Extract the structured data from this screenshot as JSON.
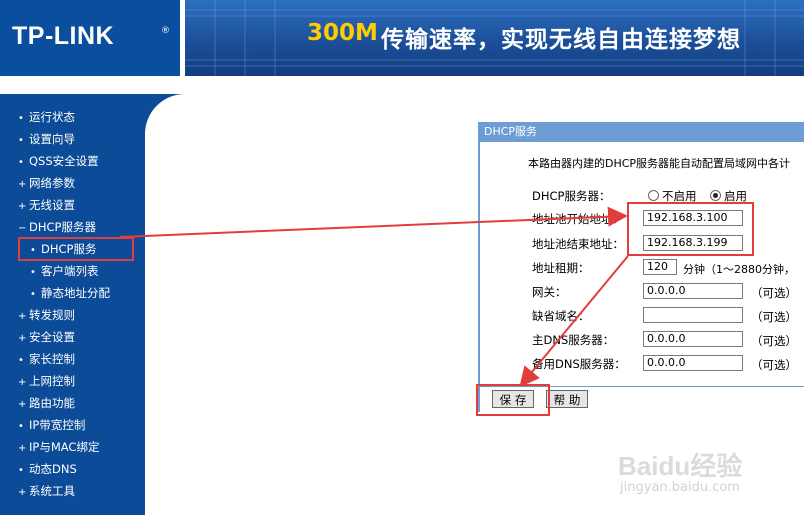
{
  "header": {
    "logo_text": "TP-LINK",
    "logo_mark": "®",
    "slogan_speed": "300M",
    "slogan_text": "传输速率，实现无线自由连接梦想"
  },
  "sidebar": {
    "items": [
      {
        "marker": "•",
        "label": "运行状态"
      },
      {
        "marker": "•",
        "label": "设置向导"
      },
      {
        "marker": "•",
        "label": "QSS安全设置"
      },
      {
        "marker": "+",
        "label": "网络参数"
      },
      {
        "marker": "+",
        "label": "无线设置"
      },
      {
        "marker": "−",
        "label": "DHCP服务器"
      },
      {
        "marker": "•",
        "label": "DHCP服务"
      },
      {
        "marker": "•",
        "label": "客户端列表"
      },
      {
        "marker": "•",
        "label": "静态地址分配"
      },
      {
        "marker": "+",
        "label": "转发规则"
      },
      {
        "marker": "+",
        "label": "安全设置"
      },
      {
        "marker": "•",
        "label": "家长控制"
      },
      {
        "marker": "+",
        "label": "上网控制"
      },
      {
        "marker": "+",
        "label": "路由功能"
      },
      {
        "marker": "•",
        "label": "IP带宽控制"
      },
      {
        "marker": "+",
        "label": "IP与MAC绑定"
      },
      {
        "marker": "•",
        "label": "动态DNS"
      },
      {
        "marker": "+",
        "label": "系统工具"
      }
    ]
  },
  "panel": {
    "title": "DHCP服务",
    "description": "本路由器内建的DHCP服务器能自动配置局域网中各计",
    "dhcp_server_label": "DHCP服务器：",
    "option_disable": "不启用",
    "option_enable": "启用",
    "pool_start_label": "地址池开始地址：",
    "pool_start_value": "192.168.3.100",
    "pool_end_label": "地址池结束地址：",
    "pool_end_value": "192.168.3.199",
    "lease_label": "地址租期：",
    "lease_value": "120",
    "lease_unit": "分钟（1～2880分钟，",
    "gateway_label": "网关：",
    "gateway_value": "0.0.0.0",
    "domain_label": "缺省域名：",
    "domain_value": "",
    "dns_primary_label": "主DNS服务器：",
    "dns_primary_value": "0.0.0.0",
    "dns_backup_label": "备用DNS服务器：",
    "dns_backup_value": "0.0.0.0",
    "optional": "（可选）",
    "save_button": "保 存",
    "help_button": "帮 助"
  },
  "watermark": {
    "brand": "Baidu经验",
    "site": "jingyan.baidu.com"
  },
  "colors": {
    "sidebar_bg": "#0c4b97",
    "header_bg": "#1c4f99",
    "panel_title_bg": "#6d9dd4",
    "highlight": "#e23c3c",
    "slogan_accent": "#ffcc00"
  }
}
